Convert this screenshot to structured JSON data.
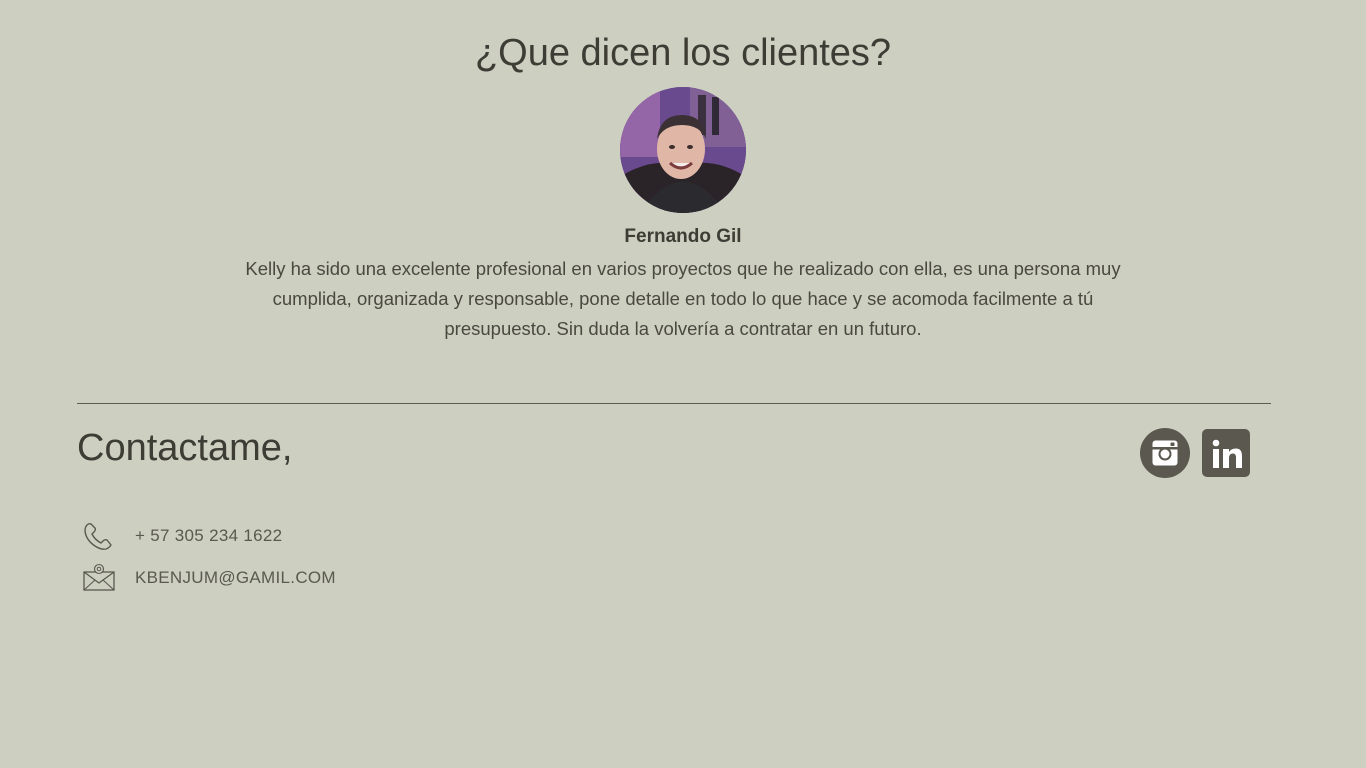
{
  "testimonials": {
    "title": "¿Que dicen los clientes?",
    "author_name": "Fernando Gil",
    "quote": "Kelly ha sido una excelente profesional en varios proyectos que he realizado con ella, es una persona muy cumplida, organizada y responsable, pone detalle en todo lo que hace y se acomoda facilmente a tú presupuesto. Sin duda la volvería a contratar en un futuro."
  },
  "contact": {
    "title": "Contactame,",
    "phone": "+ 57 305 234 1622",
    "email": "KBENJUM@GAMIL.COM",
    "phone_icon": "phone-icon",
    "email_icon": "envelope-at-icon"
  },
  "social": [
    {
      "name": "instagram",
      "icon": "instagram-icon"
    },
    {
      "name": "linkedin",
      "icon": "linkedin-icon"
    }
  ],
  "colors": {
    "background": "#cdcfc1",
    "text": "#3d3c35",
    "icon_fill": "#5b5850"
  }
}
